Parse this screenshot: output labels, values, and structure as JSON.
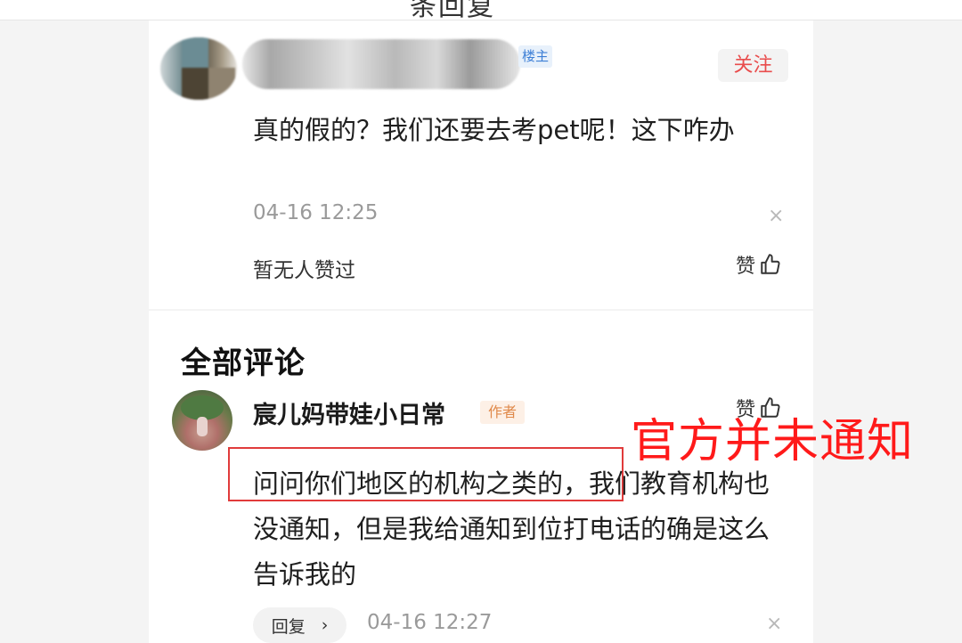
{
  "header": {
    "title": "条回复"
  },
  "post": {
    "louzhu_badge": "楼主",
    "follow_label": "关注",
    "text": "真的假的？我们还要去考pet呢！这下咋办",
    "time": "04-16 12:25",
    "close": "×",
    "likes_text": "暂无人赞过",
    "like_label": "赞"
  },
  "comments": {
    "section_title": "全部评论",
    "items": [
      {
        "author": "宸儿妈带娃小日常",
        "badge": "作者",
        "like_label": "赞",
        "text": "问问你们地区的机构之类的，我们教育机构也没通知，但是我给通知到位打电话的确是这么告诉我的",
        "reply_label": "回复",
        "reply_chevron": "›",
        "time": "04-16 12:27",
        "close": "×"
      }
    ]
  },
  "annotation": {
    "text": "官方并未通知",
    "color": "#ff1a1a"
  },
  "colors": {
    "follow": "#e94d4d",
    "louzhu_badge": "#3d7fd6",
    "author_badge": "#e0894a",
    "highlight": "#e13b3b"
  }
}
